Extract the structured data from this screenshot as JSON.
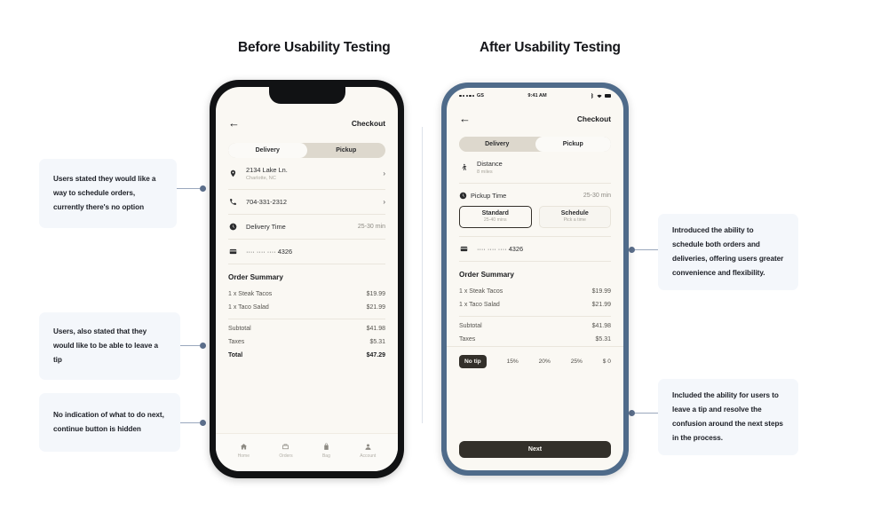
{
  "headings": {
    "before": "Before Usability Testing",
    "after": "After Usability Testing"
  },
  "colors": {
    "callout_bg": "#f4f7fb",
    "connector_dot": "#5c6f8c",
    "phone_before_frame": "#111214",
    "phone_after_frame": "#4f6b8a",
    "screen_bg": "#faf8f3",
    "accent_dark": "#33302a",
    "toggle_track": "#ddd8cd"
  },
  "callouts": {
    "left": [
      {
        "id": "schedule-orders",
        "text": "Users stated they would like a way to schedule orders, currently there's no option"
      },
      {
        "id": "leave-a-tip",
        "text": "Users, also stated that they would like to be able to leave a tip"
      },
      {
        "id": "no-next-indication",
        "text": "No indication of what to do next, continue button is hidden"
      }
    ],
    "right": [
      {
        "id": "introduced-scheduling",
        "text": "Introduced the ability to schedule both orders and deliveries, offering users greater convenience and flexibility."
      },
      {
        "id": "included-tipping",
        "text": "Included the ability for users to leave a tip and resolve the confusion around the next steps in the process."
      }
    ]
  },
  "before_phone": {
    "nav": {
      "back_icon": "arrow-left-icon",
      "title": "Checkout"
    },
    "toggle": {
      "options": [
        "Delivery",
        "Pickup"
      ],
      "selected": "Delivery"
    },
    "rows": [
      {
        "icon": "location-pin-icon",
        "label": "2134 Lake Ln.",
        "sub": "Charlotte, NC",
        "right": "",
        "chevron": "›"
      },
      {
        "icon": "phone-icon",
        "label": "704-331-2312",
        "sub": "",
        "right": "",
        "chevron": "›"
      },
      {
        "icon": "clock-icon",
        "label": "Delivery Time",
        "sub": "",
        "right": "25-30 min",
        "chevron": ""
      },
      {
        "icon": "credit-card-icon",
        "label": "···· ···· ···· 4326",
        "sub": "",
        "right": "",
        "chevron": ""
      }
    ],
    "summary": {
      "title": "Order Summary",
      "items": [
        {
          "label": "1 x Steak Tacos",
          "amount": "$19.99"
        },
        {
          "label": "1 x Taco Salad",
          "amount": "$21.99"
        }
      ],
      "totals": [
        {
          "label": "Subtotal",
          "amount": "$41.98",
          "bold": false
        },
        {
          "label": "Taxes",
          "amount": "$5.31",
          "bold": false
        },
        {
          "label": "Total",
          "amount": "$47.29",
          "bold": true
        }
      ]
    },
    "tabbar": [
      {
        "icon": "home-icon",
        "label": "Home"
      },
      {
        "icon": "orders-icon",
        "label": "Orders"
      },
      {
        "icon": "bag-icon",
        "label": "Bag"
      },
      {
        "icon": "account-icon",
        "label": "Account"
      }
    ]
  },
  "after_phone": {
    "statusbar": {
      "carrier": "GS",
      "time": "9:41 AM",
      "icons": [
        "bluetooth-icon",
        "wifi-icon",
        "battery-icon"
      ]
    },
    "nav": {
      "back_icon": "arrow-left-icon",
      "title": "Checkout"
    },
    "toggle": {
      "options": [
        "Delivery",
        "Pickup"
      ],
      "selected": "Delivery"
    },
    "distance": {
      "icon": "walking-person-icon",
      "label": "Distance",
      "value": "8 miles"
    },
    "pickup_time": {
      "icon": "clock-icon",
      "label": "Pickup Time",
      "value": "25-30 min"
    },
    "time_options": [
      {
        "title": "Standard",
        "sub": "25-40 mins",
        "selected": true
      },
      {
        "title": "Schedule",
        "sub": "Pick a time",
        "selected": false
      }
    ],
    "payment": {
      "icon": "credit-card-icon",
      "label": "···· ···· ···· 4326"
    },
    "summary": {
      "title": "Order Summary",
      "items": [
        {
          "label": "1 x Steak Tacos",
          "amount": "$19.99"
        },
        {
          "label": "1 x Taco Salad",
          "amount": "$21.99"
        }
      ],
      "totals": [
        {
          "label": "Subtotal",
          "amount": "$41.98",
          "bold": false
        },
        {
          "label": "Taxes",
          "amount": "$5.31",
          "bold": false
        }
      ]
    },
    "tips": [
      {
        "label": "No tip",
        "selected": true
      },
      {
        "label": "15%",
        "selected": false
      },
      {
        "label": "20%",
        "selected": false
      },
      {
        "label": "25%",
        "selected": false
      },
      {
        "label": "$ 0",
        "selected": false
      }
    ],
    "next_button": "Next"
  }
}
